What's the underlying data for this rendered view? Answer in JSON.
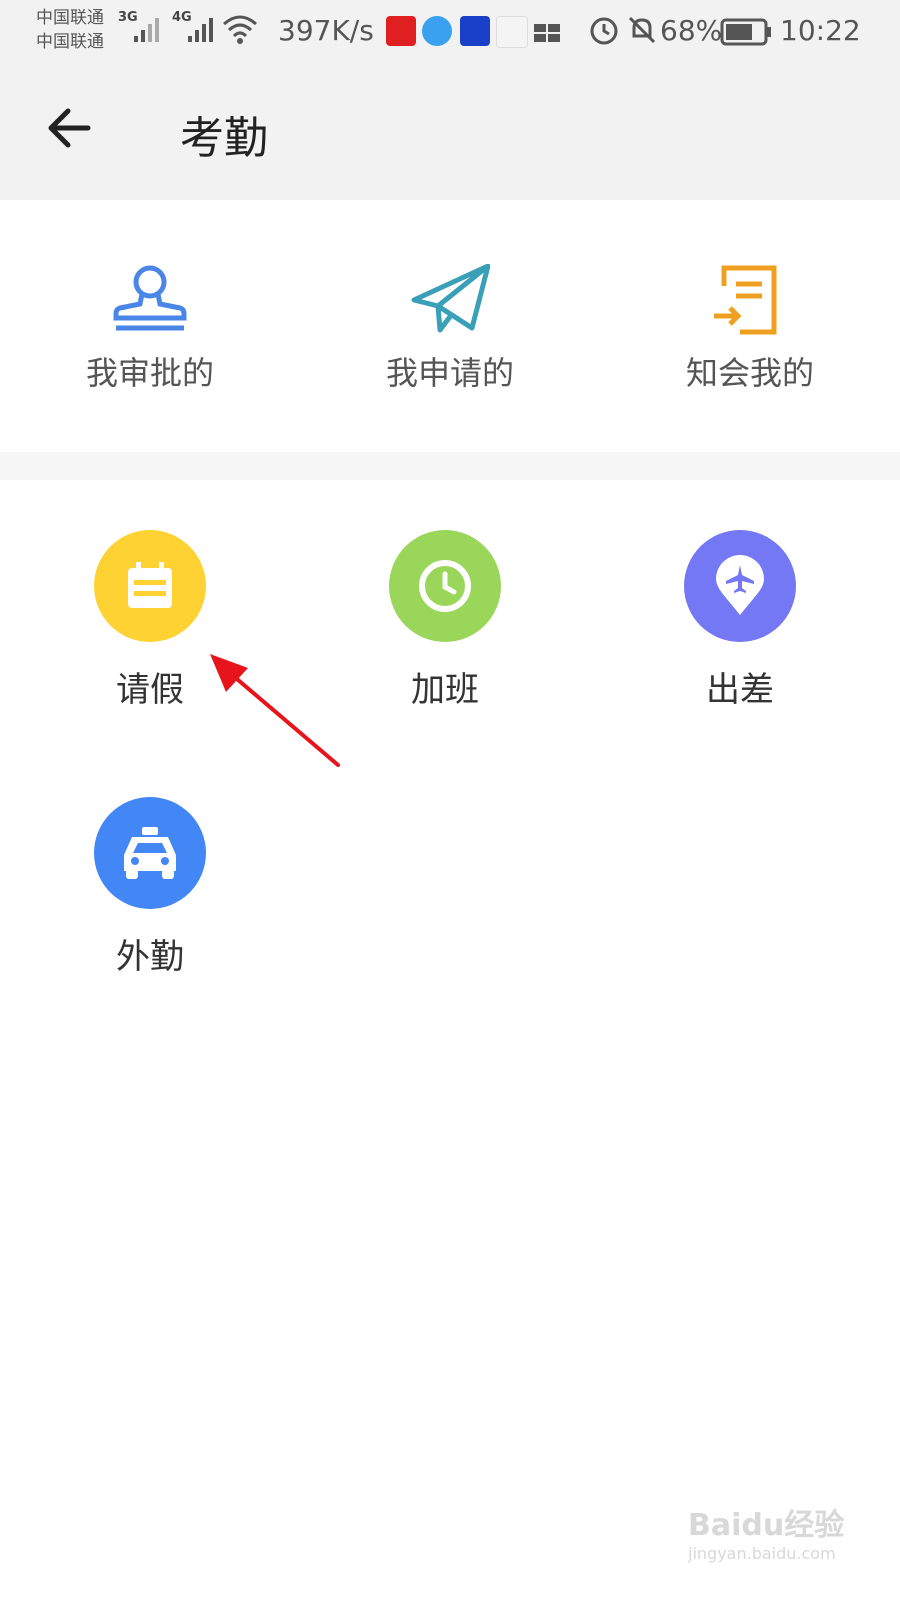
{
  "status_bar": {
    "carrier_1": "中国联通",
    "carrier_2": "中国联通",
    "sig1_label": "3G",
    "sig2_label": "4G",
    "net_speed": "397K/s",
    "battery": "68%",
    "time": "10:22"
  },
  "header": {
    "title": "考勤"
  },
  "shortcuts": [
    {
      "label": "我审批的",
      "icon": "stamp-icon",
      "color": "#4a86e8"
    },
    {
      "label": "我申请的",
      "icon": "paper-plane-icon",
      "color": "#3aa0b8"
    },
    {
      "label": "知会我的",
      "icon": "document-arrow-icon",
      "color": "#f0a020"
    }
  ],
  "tiles": [
    {
      "label": "请假",
      "icon": "calendar-icon",
      "color": "#ffd233"
    },
    {
      "label": "加班",
      "icon": "clock-icon",
      "color": "#9ad65a"
    },
    {
      "label": "出差",
      "icon": "plane-pin-icon",
      "color": "#7478f5"
    },
    {
      "label": "外勤",
      "icon": "car-icon",
      "color": "#4287f5"
    }
  ],
  "annotation_color": "#e8141c",
  "watermark": {
    "text_1": "Baidu经验",
    "text_2": "jingyan.baidu.com"
  }
}
